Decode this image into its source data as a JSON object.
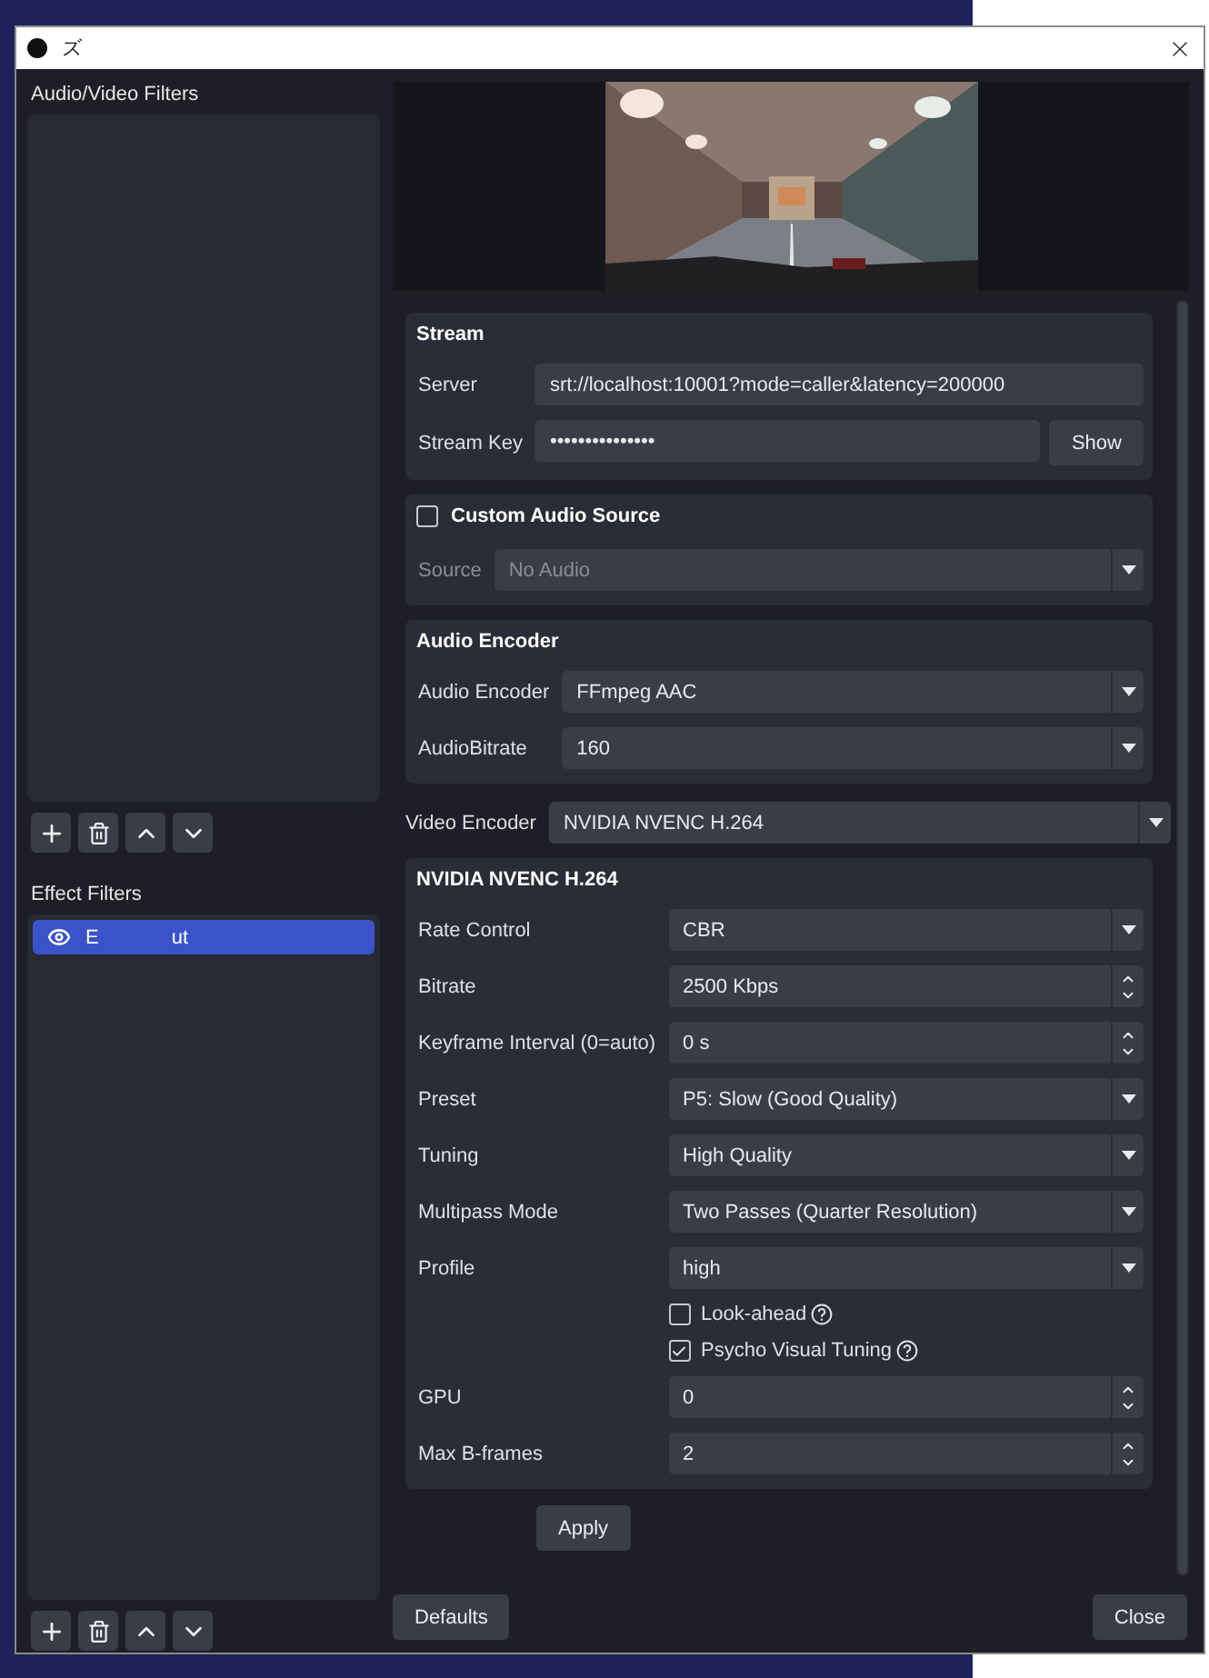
{
  "window": {
    "title": "ズ"
  },
  "audio_video_filters": {
    "title": "Audio/Video Filters"
  },
  "effect_filters": {
    "title": "Effect Filters",
    "items": [
      {
        "name_parts": [
          "E",
          "ut"
        ],
        "visible": true,
        "selected": true
      }
    ]
  },
  "sections": [
    {
      "kind": "group",
      "title": "Stream",
      "rows": [
        {
          "kind": "text",
          "label": "Server",
          "value": "srt://localhost:10001?mode=caller&latency=200000",
          "disabled": false
        },
        {
          "kind": "password",
          "label": "Stream Key",
          "value": "•••••••••••••••",
          "button": "Show",
          "disabled": false
        }
      ]
    },
    {
      "kind": "checkbox_group",
      "title": "Custom Audio Source",
      "checked": false,
      "rows": [
        {
          "kind": "select",
          "label": "Source",
          "value": "No Audio",
          "disabled": true
        }
      ]
    },
    {
      "kind": "group",
      "title": "Audio Encoder",
      "rows": [
        {
          "kind": "select",
          "label": "Audio Encoder",
          "value": "FFmpeg AAC",
          "disabled": false
        },
        {
          "kind": "select",
          "label": "AudioBitrate",
          "value": "160",
          "disabled": false
        }
      ]
    },
    {
      "kind": "row",
      "row": {
        "kind": "select",
        "label": "Video Encoder",
        "value": "NVIDIA NVENC H.264",
        "disabled": false
      }
    },
    {
      "kind": "group",
      "title": "NVIDIA NVENC H.264",
      "rows": [
        {
          "kind": "select",
          "label": "Rate Control",
          "value": "CBR",
          "disabled": false
        },
        {
          "kind": "spin",
          "label": "Bitrate",
          "value": "2500 Kbps",
          "disabled": false
        },
        {
          "kind": "spin",
          "label": "Keyframe Interval (0=auto)",
          "value": "0 s",
          "disabled": false
        },
        {
          "kind": "select",
          "label": "Preset",
          "value": "P5: Slow (Good Quality)",
          "disabled": false
        },
        {
          "kind": "select",
          "label": "Tuning",
          "value": "High Quality",
          "disabled": false
        },
        {
          "kind": "select",
          "label": "Multipass Mode",
          "value": "Two Passes (Quarter Resolution)",
          "disabled": false
        },
        {
          "kind": "select",
          "label": "Profile",
          "value": "high",
          "disabled": false
        },
        {
          "kind": "checkbox",
          "label": "Look-ahead",
          "checked": false,
          "disabled": false
        },
        {
          "kind": "checkbox",
          "label": "Psycho Visual Tuning",
          "checked": true,
          "disabled": false
        },
        {
          "kind": "spin",
          "label": "GPU",
          "value": "0",
          "disabled": false
        },
        {
          "kind": "spin",
          "label": "Max B-frames",
          "value": "2",
          "disabled": false
        }
      ]
    }
  ],
  "apply": "Apply",
  "footer": {
    "defaults": "Defaults",
    "close": "Close"
  }
}
